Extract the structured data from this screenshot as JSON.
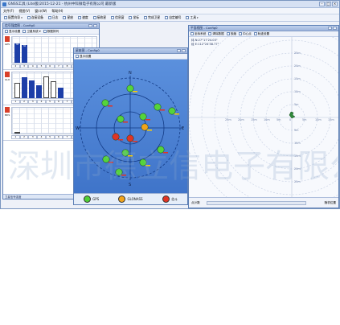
{
  "app": {
    "title": "GNSS工具 (Lite版)2015-12-21 - 杭州中科微电子有限公司 最新版",
    "menu": [
      "文件(F)",
      "视图(V)",
      "窗口(W)",
      "帮助(H)"
    ],
    "toolbar": [
      "配置向导",
      "连接设备",
      "日志",
      "星座",
      "速度",
      "接收星",
      "信息窗",
      "坐标",
      "完成卫星",
      "自定编号",
      "工具"
    ]
  },
  "snr_panel": {
    "title": "信号强度图 - Config0",
    "toolbar": [
      "显示设置",
      "卫星系统 ▾",
      "数据排列"
    ],
    "rows": [
      {
        "tag": "GPS",
        "flag_color": "#d9402a",
        "bars": [
          {
            "v": 0.75,
            "c": "blue",
            "label": "38"
          },
          {
            "v": 0.68,
            "c": "blue",
            "label": "36"
          },
          {
            "v": 0.0,
            "c": "blue",
            "label": ""
          },
          {
            "v": 0.0,
            "c": "blue",
            "label": ""
          }
        ]
      },
      {
        "tag": "GLO",
        "flag_color": "#d9402a",
        "bars": [
          {
            "v": 0.6,
            "c": "white",
            "label": ""
          },
          {
            "v": 0.8,
            "c": "blue",
            "label": ""
          },
          {
            "v": 0.7,
            "c": "blue",
            "label": ""
          },
          {
            "v": 0.5,
            "c": "blue",
            "label": ""
          },
          {
            "v": 0.85,
            "c": "white",
            "label": ""
          },
          {
            "v": 0.65,
            "c": "white",
            "label": ""
          },
          {
            "v": 0.4,
            "c": "blue",
            "label": ""
          }
        ]
      },
      {
        "tag": "BDS",
        "flag_color": "#d9402a",
        "bars": [
          {
            "v": 0.0,
            "c": "white",
            "label": ""
          }
        ]
      }
    ],
    "prn_rows": [
      [
        "2",
        "3",
        "4",
        "5",
        "6",
        "7",
        "8",
        "9",
        "10",
        "11"
      ],
      [
        "1",
        "2",
        "3",
        "4",
        "5",
        "6",
        "7",
        "8",
        "9",
        "10"
      ],
      [
        "1",
        "2",
        "3",
        "4",
        "5",
        "6",
        "7",
        "8",
        "9",
        "10"
      ]
    ],
    "status": "卫星信号强度"
  },
  "sky_panel": {
    "title": "星座图 - Config0",
    "toolbar_label": "显示设置",
    "compass": {
      "n": "N",
      "s": "S",
      "e": "E",
      "w": "W"
    },
    "elev_labels": [
      "0",
      "30",
      "60"
    ],
    "legend": [
      {
        "label": "GPS",
        "color": "#4fcf36"
      },
      {
        "label": "GLONASS",
        "color": "#f2a41b"
      },
      {
        "label": "北斗",
        "color": "#e03424"
      }
    ]
  },
  "pos_panel": {
    "title": "平面视图 - Config0",
    "toolbar": [
      "坐标系统",
      "清除数据",
      "放缩",
      "中心点",
      "轨迹设置"
    ],
    "info_lat": "纬  N:27°17'24.03\"",
    "info_lon": "经  E:112°24'38.77\"",
    "x_ticks": [
      "25m",
      "20m",
      "15m",
      "10m",
      "5m",
      "0",
      "5m",
      "10m",
      "15m",
      "20m",
      "25m"
    ],
    "y_ticks": [
      "25m",
      "20m",
      "15m",
      "10m",
      "5m",
      "0",
      "5m",
      "10m",
      "15m",
      "20m",
      "25m"
    ],
    "footer_left": "点计数",
    "footer_right": "随机位置"
  },
  "watermark": {
    "text": "深圳市德立信电子有限公司"
  }
}
